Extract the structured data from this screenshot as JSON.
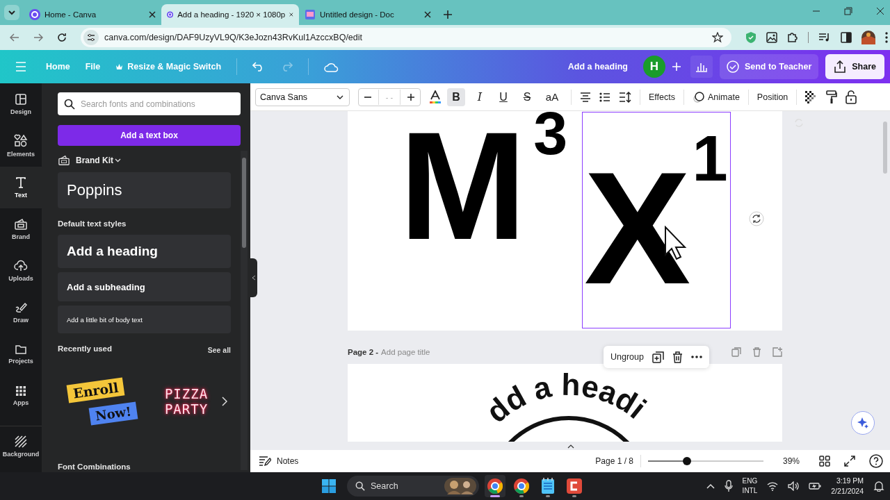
{
  "browser": {
    "tabs": [
      {
        "title": "Home - Canva",
        "selected": false
      },
      {
        "title": "Add a heading - 1920 × 1080p",
        "selected": true
      },
      {
        "title": "Untitled design - Doc",
        "selected": false
      }
    ],
    "url": "canva.com/design/DAF9UzyVL9Q/K3eJozn43RvKul1AzccxBQ/edit"
  },
  "header": {
    "menu": [
      "Home",
      "File",
      "Resize & Magic Switch"
    ],
    "redo_disabled": true,
    "design_title": "Add a heading",
    "avatar": "H",
    "send_button": "Send to Teacher",
    "share_button": "Share"
  },
  "rail": [
    {
      "label": "Design",
      "selected": false
    },
    {
      "label": "Elements",
      "selected": false
    },
    {
      "label": "Text",
      "selected": true
    },
    {
      "label": "Brand",
      "selected": false
    },
    {
      "label": "Uploads",
      "selected": false
    },
    {
      "label": "Draw",
      "selected": false
    },
    {
      "label": "Projects",
      "selected": false
    },
    {
      "label": "Apps",
      "selected": false
    },
    {
      "label": "Background",
      "selected": false
    }
  ],
  "panel": {
    "search_placeholder": "Search fonts and combinations",
    "add_button": "Add a text box",
    "brand_kit": "Brand Kit",
    "brand_font": "Poppins",
    "styles_heading": "Default text styles",
    "styles": [
      {
        "kind": "heading",
        "label": "Add a heading"
      },
      {
        "kind": "subheading",
        "label": "Add a subheading"
      },
      {
        "kind": "body",
        "label": "Add a little bit of body text"
      }
    ],
    "recent_heading": "Recently used",
    "see_all": "See all",
    "recent": [
      {
        "kind": "badges",
        "lines": [
          "Enroll",
          "Now!"
        ]
      },
      {
        "kind": "neon",
        "lines": [
          "PIZZA",
          "PARTY"
        ]
      }
    ],
    "next_heading": "Font Combinations"
  },
  "toolbar": {
    "font": "Canva Sans",
    "size": "- -",
    "styles": [
      {
        "label": "B",
        "kind": "bold",
        "selected": true
      },
      {
        "label": "I",
        "kind": "italic",
        "selected": false
      },
      {
        "label": "U",
        "kind": "underline",
        "selected": false
      },
      {
        "label": "S",
        "kind": "strike",
        "selected": false
      },
      {
        "label": "aA",
        "kind": "case",
        "selected": false
      }
    ],
    "effects": "Effects",
    "animate": "Animate",
    "position": "Position"
  },
  "canvas": {
    "page1": [
      {
        "text": "M$^{3}$",
        "selected": false
      },
      {
        "text": "X$^{1}$",
        "selected": true
      }
    ],
    "page2_label": "Page 2 -",
    "page2_title_placeholder": "Add page title",
    "page2_text": "dd a headi",
    "context_button": "Ungroup"
  },
  "footer": {
    "notes": "Notes",
    "page": "Page 1 / 8",
    "level": 0.34,
    "zoom": "39%"
  },
  "taskbar": {
    "search": "Search",
    "apps": [
      {
        "kind": "browser",
        "selected": true
      },
      {
        "kind": "browser",
        "selected": false
      },
      {
        "kind": "notepad",
        "selected": false
      },
      {
        "kind": "recorder",
        "selected": false
      }
    ],
    "lang": [
      "ENG",
      "INTL"
    ],
    "time": "3:19 PM",
    "date": "2/21/2024"
  }
}
